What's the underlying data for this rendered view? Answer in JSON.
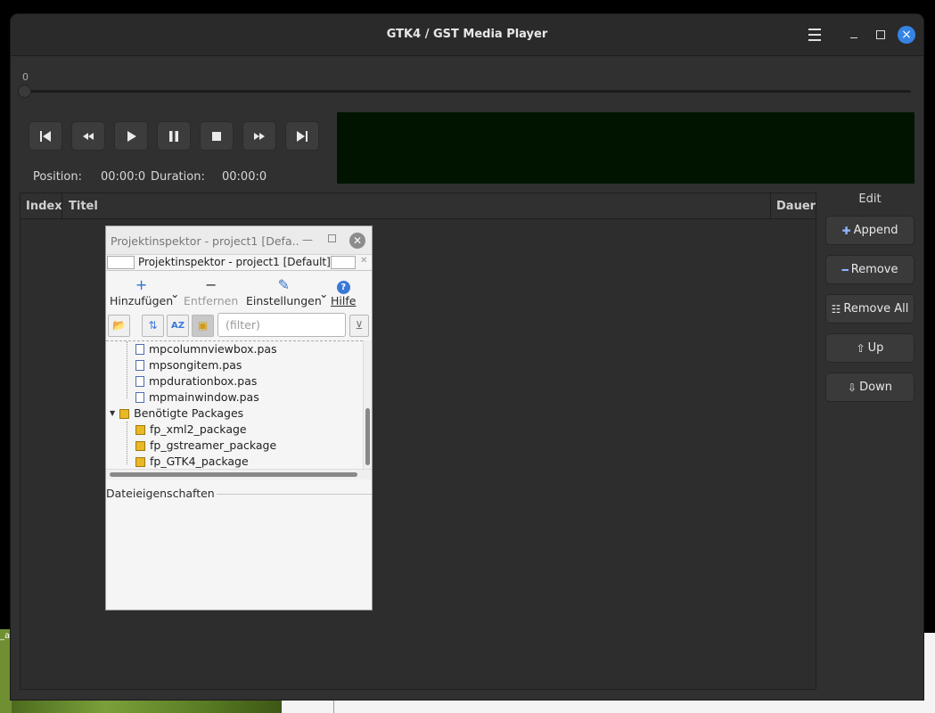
{
  "window": {
    "title": "GTK4 / GST Media Player"
  },
  "seek": {
    "value_label": "0"
  },
  "transport": {
    "buttons": [
      "skip-back",
      "rewind",
      "play",
      "pause",
      "stop",
      "fast-forward",
      "skip-forward"
    ]
  },
  "position": {
    "position_label": "Position:",
    "position_value": "00:00:0",
    "duration_label": "Duration:",
    "duration_value": "00:00:0"
  },
  "playlist": {
    "columns": [
      "Index",
      "Titel",
      "Dauer"
    ]
  },
  "edit": {
    "label": "Edit",
    "buttons": {
      "append": "Append",
      "remove": "Remove",
      "remove_all": "Remove All",
      "up": "Up",
      "down": "Down"
    }
  },
  "inspector": {
    "title": "Projektinspektor - project1 [Defa...",
    "tab_title": "Projektinspektor - project1 [Default]",
    "toolbar": {
      "add": "Hinzufügen",
      "remove": "Entfernen",
      "settings": "Einstellungen",
      "help": "Hilfe"
    },
    "filter_placeholder": "(filter)",
    "tree": {
      "files": [
        "mpcolumnviewbox.pas",
        "mpsongitem.pas",
        "mpdurationbox.pas",
        "mpmainwindow.pas"
      ],
      "packages_label": "Benötigte Packages",
      "packages": [
        "fp_xml2_package",
        "fp_gstreamer_package",
        "fp_GTK4_package"
      ]
    },
    "properties_label": "Dateieigenschaften"
  },
  "desktop": {
    "snippet": "_a"
  },
  "colors": {
    "accent": "#3584e4",
    "video_bg": "#001400"
  }
}
